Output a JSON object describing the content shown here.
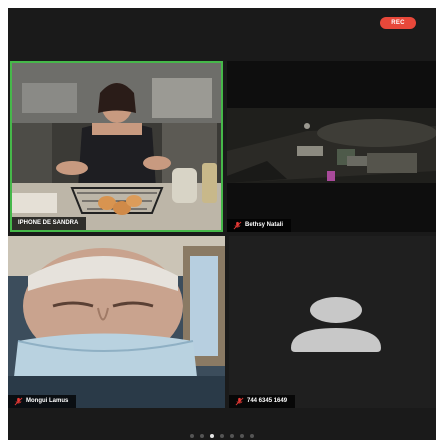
{
  "header": {
    "rec_label": "REC"
  },
  "participants": [
    {
      "name": "IPHONE DE SANDRA",
      "muted": false,
      "active_speaker": true
    },
    {
      "name": "Bethsy Natali",
      "muted": true,
      "active_speaker": false
    },
    {
      "name": "Mongui Lamus",
      "muted": true,
      "active_speaker": false
    },
    {
      "name": "744 6345 1649",
      "muted": true,
      "active_speaker": false,
      "video_off": true
    }
  ],
  "pager": {
    "page_count": 7,
    "active_page": 3
  },
  "colors": {
    "active_border": "#46b84a",
    "rec_badge": "#e8483a",
    "mute_icon": "#e53935",
    "background": "#1a1a1a"
  }
}
